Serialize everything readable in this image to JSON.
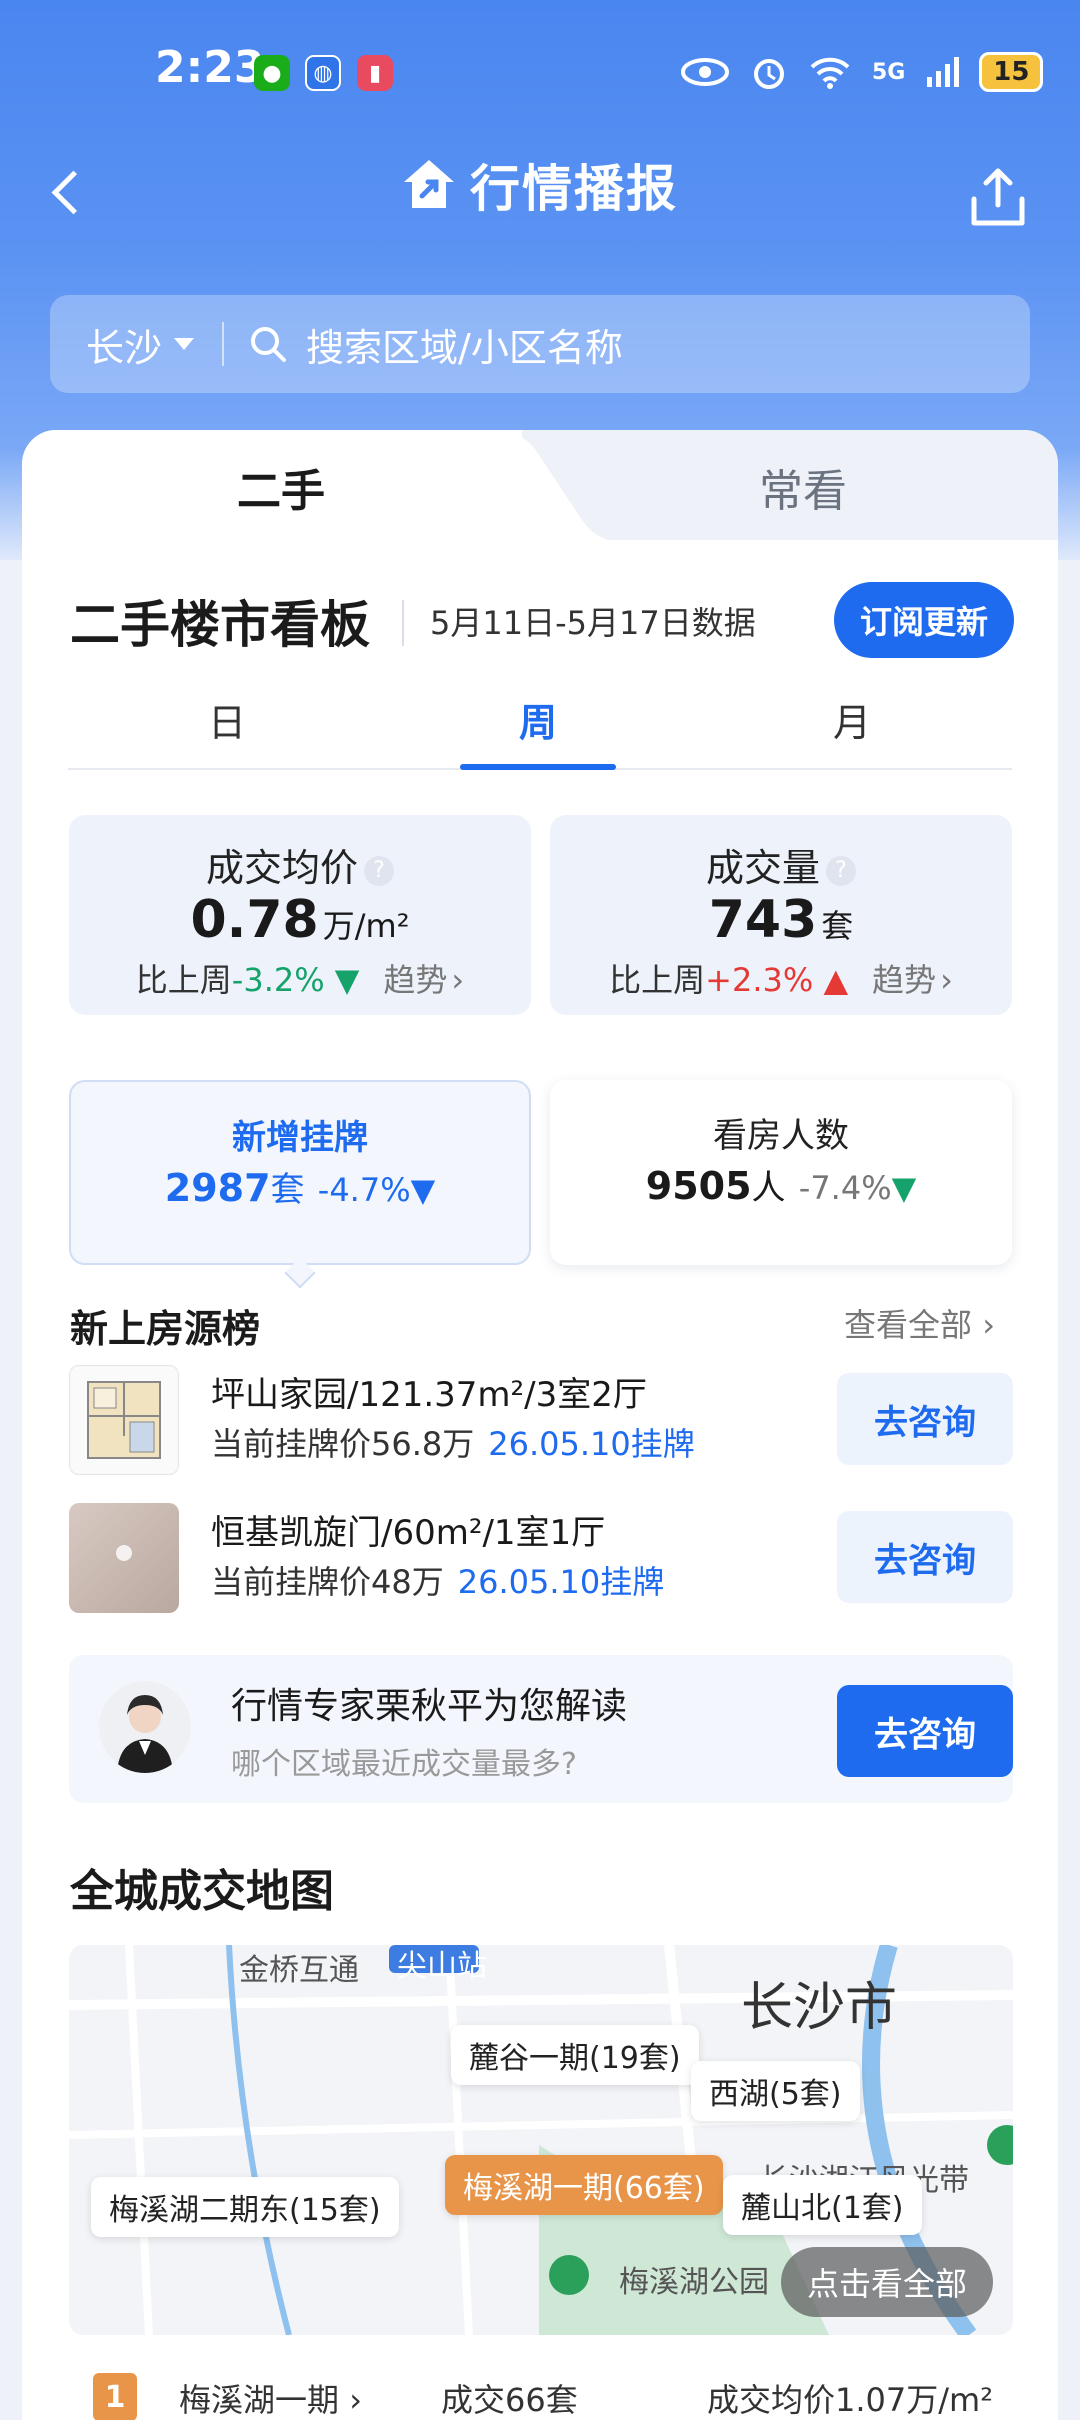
{
  "status_bar": {
    "time": "2:23",
    "battery": "15",
    "network": "5G"
  },
  "header": {
    "title": "行情播报"
  },
  "search": {
    "city": "长沙",
    "placeholder": "搜索区域/小区名称"
  },
  "tabs": [
    {
      "label": "二手",
      "active": true
    },
    {
      "label": "常看",
      "active": false
    }
  ],
  "board": {
    "title": "二手楼市看板",
    "date_range": "5月11日-5月17日数据",
    "subscribe_label": "订阅更新",
    "periods": [
      {
        "label": "日",
        "active": false
      },
      {
        "label": "周",
        "active": true
      },
      {
        "label": "月",
        "active": false
      }
    ]
  },
  "stats": {
    "avg_price": {
      "label": "成交均价",
      "value": "0.78",
      "unit": "万/m²",
      "compare_prefix": "比上周",
      "change": "-3.2%",
      "trend_label": "趋势"
    },
    "volume": {
      "label": "成交量",
      "value": "743",
      "unit": "套",
      "compare_prefix": "比上周",
      "change": "+2.3%",
      "trend_label": "趋势"
    },
    "new_listings": {
      "label": "新增挂牌",
      "value": "2987",
      "unit": "套",
      "change": "-4.7%"
    },
    "visitors": {
      "label": "看房人数",
      "value": "9505",
      "unit": "人",
      "change": "-7.4%"
    }
  },
  "new_listings_section": {
    "title": "新上房源榜",
    "view_all": "查看全部",
    "items": [
      {
        "name": "坪山家园/121.37m²/3室2厅",
        "price_text": "当前挂牌价56.8万",
        "listed_date": "26.05.10挂牌",
        "button": "去咨询"
      },
      {
        "name": "恒基凯旋门/60m²/1室1厅",
        "price_text": "当前挂牌价48万",
        "listed_date": "26.05.10挂牌",
        "button": "去咨询"
      }
    ]
  },
  "expert": {
    "title": "行情专家栗秋平为您解读",
    "subtitle": "哪个区域最近成交量最多?",
    "button": "去咨询"
  },
  "map": {
    "title": "全城成交地图",
    "city": "长沙市",
    "view_all": "点击看全部",
    "labels": [
      {
        "name": "麓谷一期(19套)",
        "hot": false
      },
      {
        "name": "西湖(5套)",
        "hot": false
      },
      {
        "name": "梅溪湖一期(66套)",
        "hot": true
      },
      {
        "name": "梅溪湖二期东(15套)",
        "hot": false
      },
      {
        "name": "麓山北(1套)",
        "hot": false
      }
    ],
    "place_texts": [
      "金桥互通",
      "尖山站",
      "长沙湘江风光带",
      "梅溪湖公园"
    ]
  },
  "ranking": {
    "rank": "1",
    "name": "梅溪湖一期",
    "volume": "成交66套",
    "avg_price": "成交均价1.07万/m²"
  },
  "colors": {
    "primary": "#1e6bf0",
    "down": "#15a36b",
    "up": "#e53935",
    "hot": "#e8954a"
  }
}
